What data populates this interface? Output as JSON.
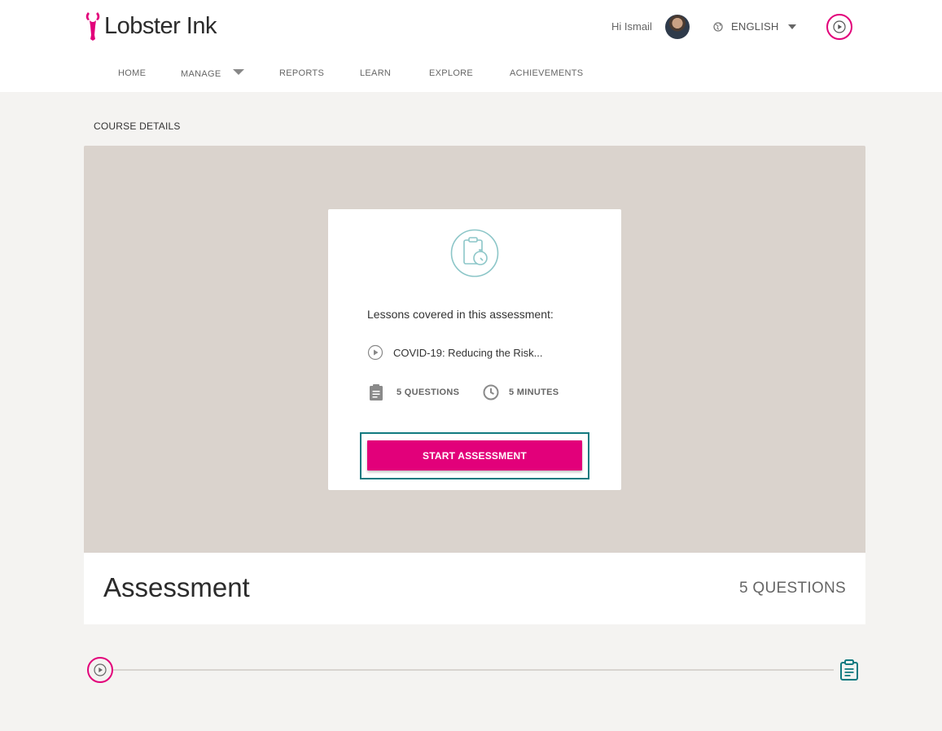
{
  "brand": {
    "name": "Lobster Ink",
    "color": "#e2007a",
    "accent": "#117a80"
  },
  "user": {
    "greeting": "Hi Ismail"
  },
  "language": {
    "label": "ENGLISH"
  },
  "nav": {
    "items": [
      {
        "label": "HOME"
      },
      {
        "label": "MANAGE"
      },
      {
        "label": "REPORTS"
      },
      {
        "label": "LEARN"
      },
      {
        "label": "EXPLORE"
      },
      {
        "label": "ACHIEVEMENTS"
      }
    ]
  },
  "breadcrumb": {
    "label": "COURSE DETAILS"
  },
  "assessment_card": {
    "icon": "clipboard-stopwatch-icon",
    "heading": "Lessons covered in this assessment:",
    "lessons": [
      {
        "title": "COVID-19: Reducing the Risk..."
      }
    ],
    "questions": "5 QUESTIONS",
    "duration": "5 MINUTES",
    "start_label": "START ASSESSMENT"
  },
  "info": {
    "title": "Assessment",
    "count": "5 QUESTIONS"
  }
}
